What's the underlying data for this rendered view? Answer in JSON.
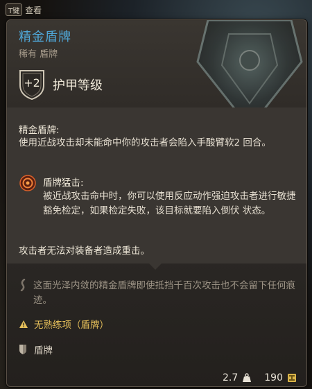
{
  "hint": {
    "key": "T键",
    "label": "查看"
  },
  "item": {
    "name": "精金盾牌",
    "subtitle": "稀有 盾牌",
    "armor_class_value": "+2",
    "armor_class_label": "护甲等级"
  },
  "ability": {
    "title": "精金盾牌:",
    "description": "使用近战攻击却未能命中你的攻击者会陷入手酸臂软2 回合。"
  },
  "sub_ability": {
    "title": "盾牌猛击:",
    "description": "被近战攻击命中时，你可以使用反应动作强迫攻击者进行敏捷豁免检定，如果检定失败，该目标就要陷入倒伏 状态。"
  },
  "note": "攻击者无法对装备者造成重击。",
  "flavor": "这面光泽内敛的精金盾牌即使抵挡千百次攻击也不会留下任何痕迹。",
  "proficiency_warning": "无熟练项（盾牌）",
  "item_type": "盾牌",
  "weight": "2.7",
  "price": "190",
  "colors": {
    "name": "#4fa7d8",
    "warning": "#e6c05a",
    "flavor": "#9d9486"
  }
}
